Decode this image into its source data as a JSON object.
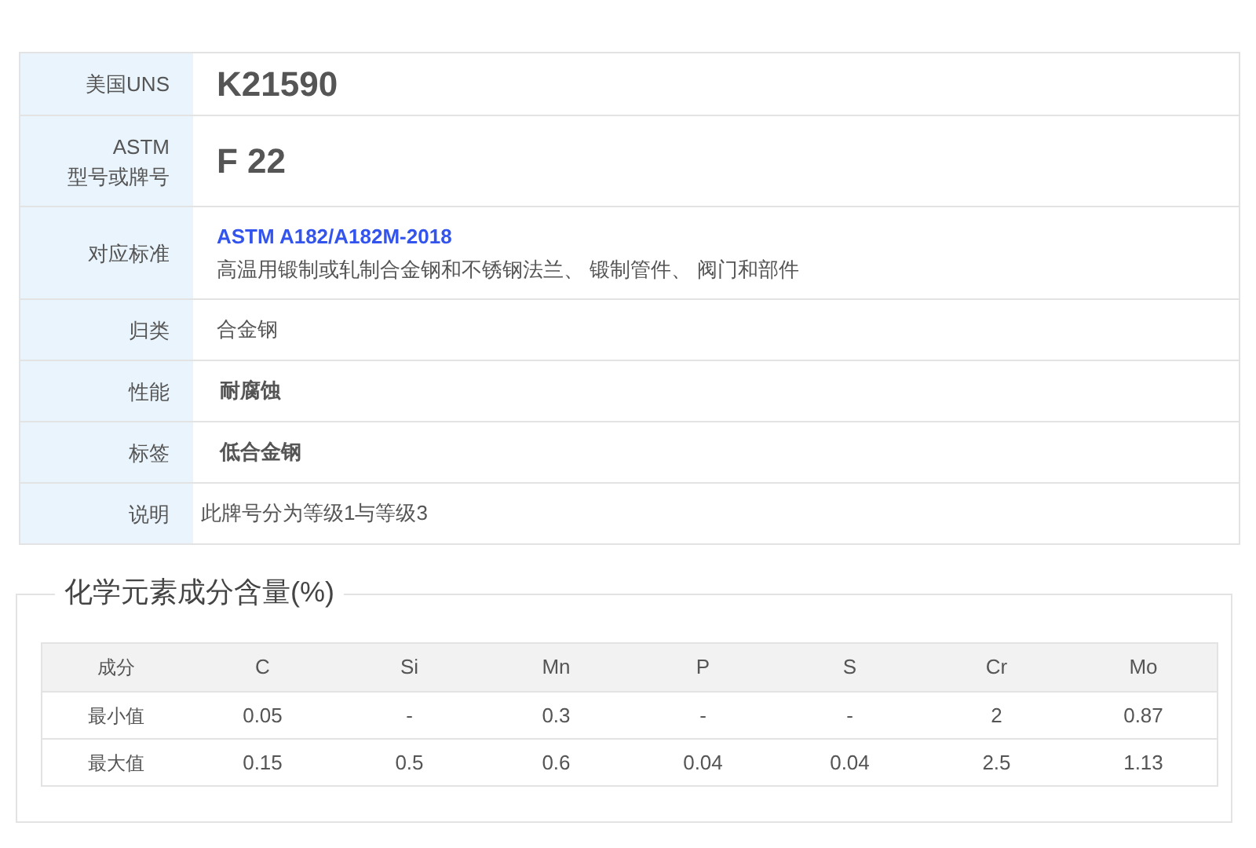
{
  "info": [
    {
      "label": "美国UNS",
      "kind": "big",
      "value": "K21590"
    },
    {
      "label": "ASTM\n型号或牌号",
      "kind": "big",
      "value": "F 22"
    },
    {
      "label": "对应标准",
      "kind": "standard",
      "link": "ASTM A182/A182M-2018",
      "value": "高温用锻制或轧制合金钢和不锈钢法兰、 锻制管件、 阀门和部件"
    },
    {
      "label": "归类",
      "kind": "plain",
      "value": "合金钢"
    },
    {
      "label": "性能",
      "kind": "bold",
      "value": "耐腐蚀"
    },
    {
      "label": "标签",
      "kind": "bold",
      "value": "低合金钢"
    },
    {
      "label": "说明",
      "kind": "note",
      "value": "此牌号分为等级1与等级3"
    }
  ],
  "composition": {
    "title": "化学元素成分含量(%)",
    "columns": [
      "成分",
      "C",
      "Si",
      "Mn",
      "P",
      "S",
      "Cr",
      "Mo"
    ],
    "rows": [
      [
        "最小值",
        "0.05",
        "-",
        "0.3",
        "-",
        "-",
        "2",
        "0.87"
      ],
      [
        "最大值",
        "0.15",
        "0.5",
        "0.6",
        "0.04",
        "0.04",
        "2.5",
        "1.13"
      ]
    ]
  }
}
